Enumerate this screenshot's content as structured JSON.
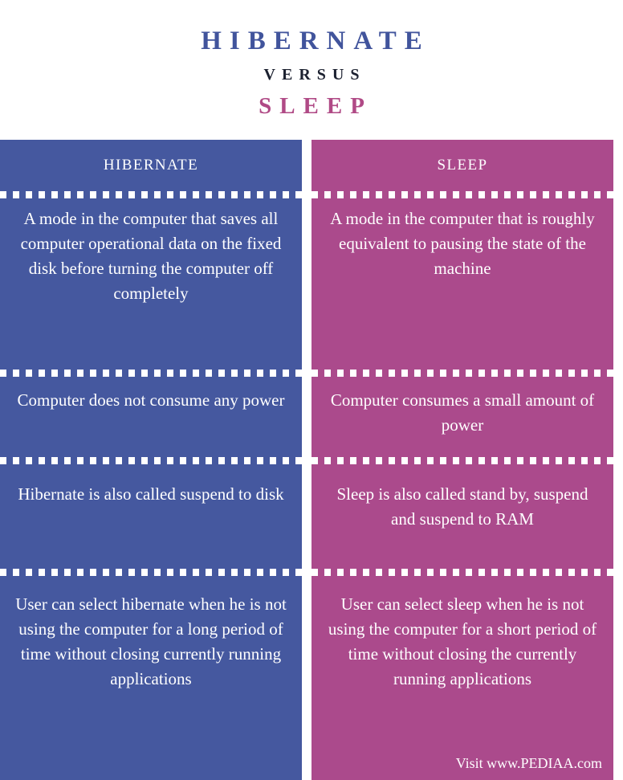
{
  "title": {
    "main": "HIBERNATE",
    "versus": "VERSUS",
    "sub": "SLEEP"
  },
  "colors": {
    "hibernate": "#45589f",
    "sleep": "#ab4a8c",
    "title_main": "#41549c",
    "title_sub": "#b04a86",
    "versus": "#1c2130",
    "background": "#ffffff",
    "text": "#ffffff"
  },
  "table": {
    "columns": [
      {
        "header": "HIBERNATE",
        "theme": "hibernate"
      },
      {
        "header": "SLEEP",
        "theme": "sleep"
      }
    ],
    "rows": [
      {
        "hibernate": "A mode in the computer that saves all computer operational data on the fixed disk before turning the computer off completely",
        "sleep": "A mode in the computer that is roughly equivalent to pausing the state of the machine"
      },
      {
        "hibernate": "Computer does not consume any power",
        "sleep": "Computer consumes a small amount of power"
      },
      {
        "hibernate": "Hibernate is also called suspend to disk",
        "sleep": "Sleep is also called stand by, suspend and suspend to RAM"
      },
      {
        "hibernate": "User can select hibernate when he is not using the computer for a long period of time without closing currently running applications",
        "sleep": "User can select sleep when he is not using the computer for a short period of time without closing the currently running applications"
      }
    ]
  },
  "footer": {
    "attribution": "Visit www.PEDIAA.com"
  }
}
